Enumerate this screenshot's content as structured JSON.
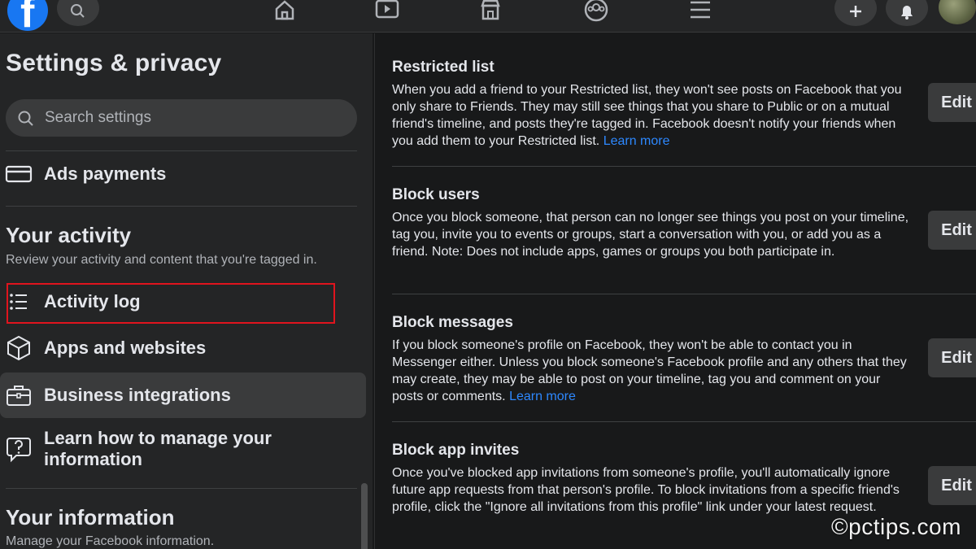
{
  "topbar": {
    "logo_letter": "f",
    "nav_icons": [
      "home-icon",
      "watch-icon",
      "marketplace-icon",
      "groups-icon",
      "menu-icon"
    ],
    "right_icons": [
      "plus-icon",
      "bell-icon"
    ]
  },
  "sidebar": {
    "title": "Settings & privacy",
    "search_placeholder": "Search settings",
    "ads_payments": "Ads payments",
    "your_activity": {
      "title": "Your activity",
      "subtitle": "Review your activity and content that you're tagged in.",
      "items": [
        {
          "label": "Activity log",
          "icon": "list-icon"
        },
        {
          "label": "Apps and websites",
          "icon": "cube-icon"
        },
        {
          "label": "Business integrations",
          "icon": "briefcase-icon"
        },
        {
          "label": "Learn how to manage your information",
          "icon": "help-bubble-icon"
        }
      ]
    },
    "your_information": {
      "title": "Your information",
      "subtitle": "Manage your Facebook information."
    }
  },
  "content": {
    "blocks": [
      {
        "title": "Restricted list",
        "desc": "When you add a friend to your Restricted list, they won't see posts on Facebook that you only share to Friends. They may still see things that you share to Public or on a mutual friend's timeline, and posts they're tagged in. Facebook doesn't notify your friends when you add them to your Restricted list.",
        "link": "Learn more",
        "button": "Edit"
      },
      {
        "title": "Block users",
        "desc": "Once you block someone, that person can no longer see things you post on your timeline, tag you, invite you to events or groups, start a conversation with you, or add you as a friend. Note: Does not include apps, games or groups you both participate in.",
        "link": "",
        "button": "Edit"
      },
      {
        "title": "Block messages",
        "desc": "If you block someone's profile on Facebook, they won't be able to contact you in Messenger either. Unless you block someone's Facebook profile and any others that they may create, they may be able to post on your timeline, tag you and comment on your posts or comments.",
        "link": "Learn more",
        "button": "Edit"
      },
      {
        "title": "Block app invites",
        "desc": "Once you've blocked app invitations from someone's profile, you'll automatically ignore future app requests from that person's profile. To block invitations from a specific friend's profile, click the \"Ignore all invitations from this profile\" link under your latest request.",
        "link": "",
        "button": "Edit"
      }
    ]
  },
  "watermark": "©pctips.com",
  "colors": {
    "accent": "#1877f2",
    "link": "#2d88ff",
    "highlight": "#e0141e"
  }
}
